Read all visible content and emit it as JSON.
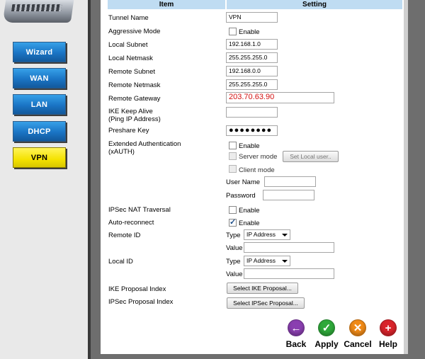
{
  "nav": {
    "wizard": "Wizard",
    "wan": "WAN",
    "lan": "LAN",
    "dhcp": "DHCP",
    "vpn": "VPN"
  },
  "table": {
    "col_item": "Item",
    "col_setting": "Setting"
  },
  "form": {
    "tunnel_name_label": "Tunnel Name",
    "tunnel_name_value": "VPN",
    "aggressive_label": "Aggressive Mode",
    "aggressive_enable": "Enable",
    "local_subnet_label": "Local Subnet",
    "local_subnet_value": "192.168.1.0",
    "local_netmask_label": "Local Netmask",
    "local_netmask_value": "255.255.255.0",
    "remote_subnet_label": "Remote Subnet",
    "remote_subnet_value": "192.168.0.0",
    "remote_netmask_label": "Remote Netmask",
    "remote_netmask_value": "255.255.255.0",
    "remote_gateway_label": "Remote Gateway",
    "remote_gateway_value": "203.70.63.90",
    "ike_keepalive_label_1": "IKE Keep Alive",
    "ike_keepalive_label_2": "(Ping IP Address)",
    "ike_keepalive_value": "",
    "preshare_label": "Preshare Key",
    "preshare_value": "●●●●●●●●",
    "xauth_label_1": "Extended Authentication",
    "xauth_label_2": "(xAUTH)",
    "xauth_enable": "Enable",
    "server_mode": "Server mode",
    "set_local_user": "Set Local user..",
    "client_mode": "Client mode",
    "user_name_label": "User Name",
    "password_label": "Password",
    "nat_traversal_label": "IPSec NAT Traversal",
    "nat_traversal_enable": "Enable",
    "auto_reconnect_label": "Auto-reconnect",
    "auto_reconnect_enable": "Enable",
    "remote_id_label": "Remote ID",
    "remote_id_type_label": "Type",
    "remote_id_type_value": "IP Address",
    "remote_id_value_label": "Value",
    "local_id_label": "Local ID",
    "local_id_type_label": "Type",
    "local_id_type_value": "IP Address",
    "local_id_value_label": "Value",
    "ike_proposal_label": "IKE Proposal Index",
    "ike_proposal_button": "Select IKE Proposal...",
    "ipsec_proposal_label": "IPSec Proposal Index",
    "ipsec_proposal_button": "Select IPSec Proposal..."
  },
  "actions": {
    "back": "Back",
    "apply": "Apply",
    "cancel": "Cancel",
    "help": "Help"
  },
  "checkbox_state": {
    "aggressive": false,
    "xauth": false,
    "server_mode": false,
    "client_mode": false,
    "nat_traversal": false,
    "auto_reconnect": true
  },
  "colors": {
    "header_bg": "#bfdcf2",
    "nav_blue": "#1a74c4",
    "nav_active": "#f4e200",
    "gateway_text": "#d31010",
    "back": "#8a3fb0",
    "apply": "#2fa93a",
    "cancel": "#f08a17",
    "help": "#d9242b"
  }
}
